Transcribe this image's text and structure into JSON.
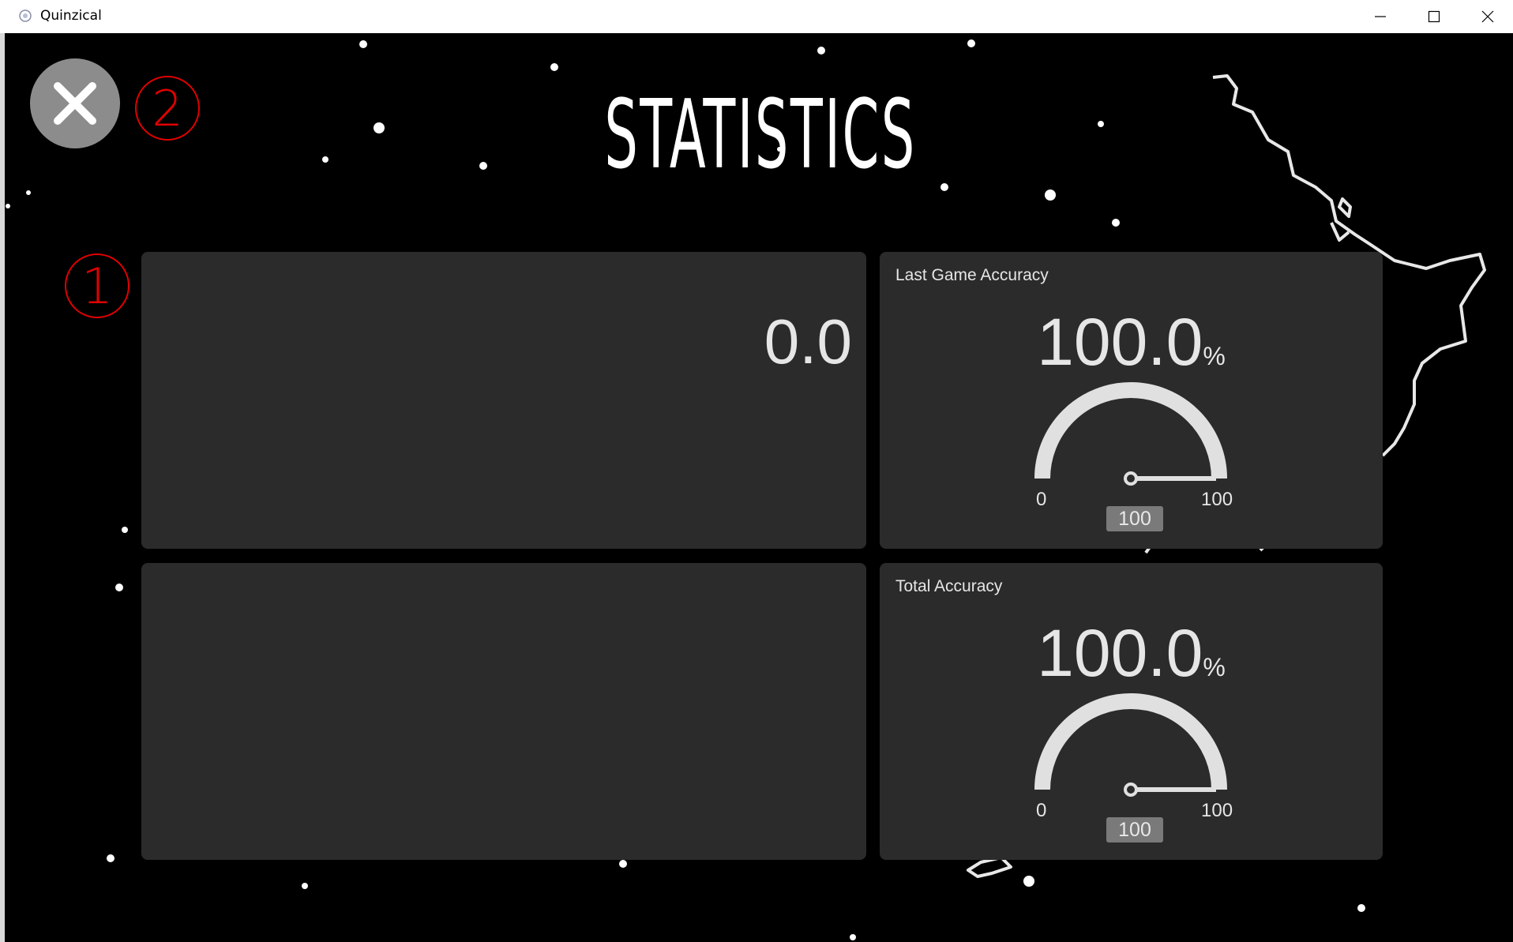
{
  "window": {
    "title": "Quinzical",
    "minimize_icon": "minimize-icon",
    "maximize_icon": "maximize-icon",
    "close_icon": "close-icon"
  },
  "screen": {
    "title": "STATISTICS",
    "back_button_icon": "close-icon",
    "annotations": [
      "1",
      "2"
    ]
  },
  "tiles": {
    "winnings_value": "0.0",
    "empty_tile": ""
  },
  "gauges": [
    {
      "label": "Last Game Accuracy",
      "value": "100.0",
      "unit": "%",
      "min": "0",
      "max": "100",
      "badge": "100",
      "level": 1.0
    },
    {
      "label": "Total Accuracy",
      "value": "100.0",
      "unit": "%",
      "min": "0",
      "max": "100",
      "badge": "100",
      "level": 1.0
    }
  ],
  "colors": {
    "background": "#000000",
    "tile": "#2b2b2b",
    "text": "#e6e6e6",
    "gauge": "#e0e0e0",
    "annotation": "#e00000",
    "back_button": "#8c8c8c"
  }
}
